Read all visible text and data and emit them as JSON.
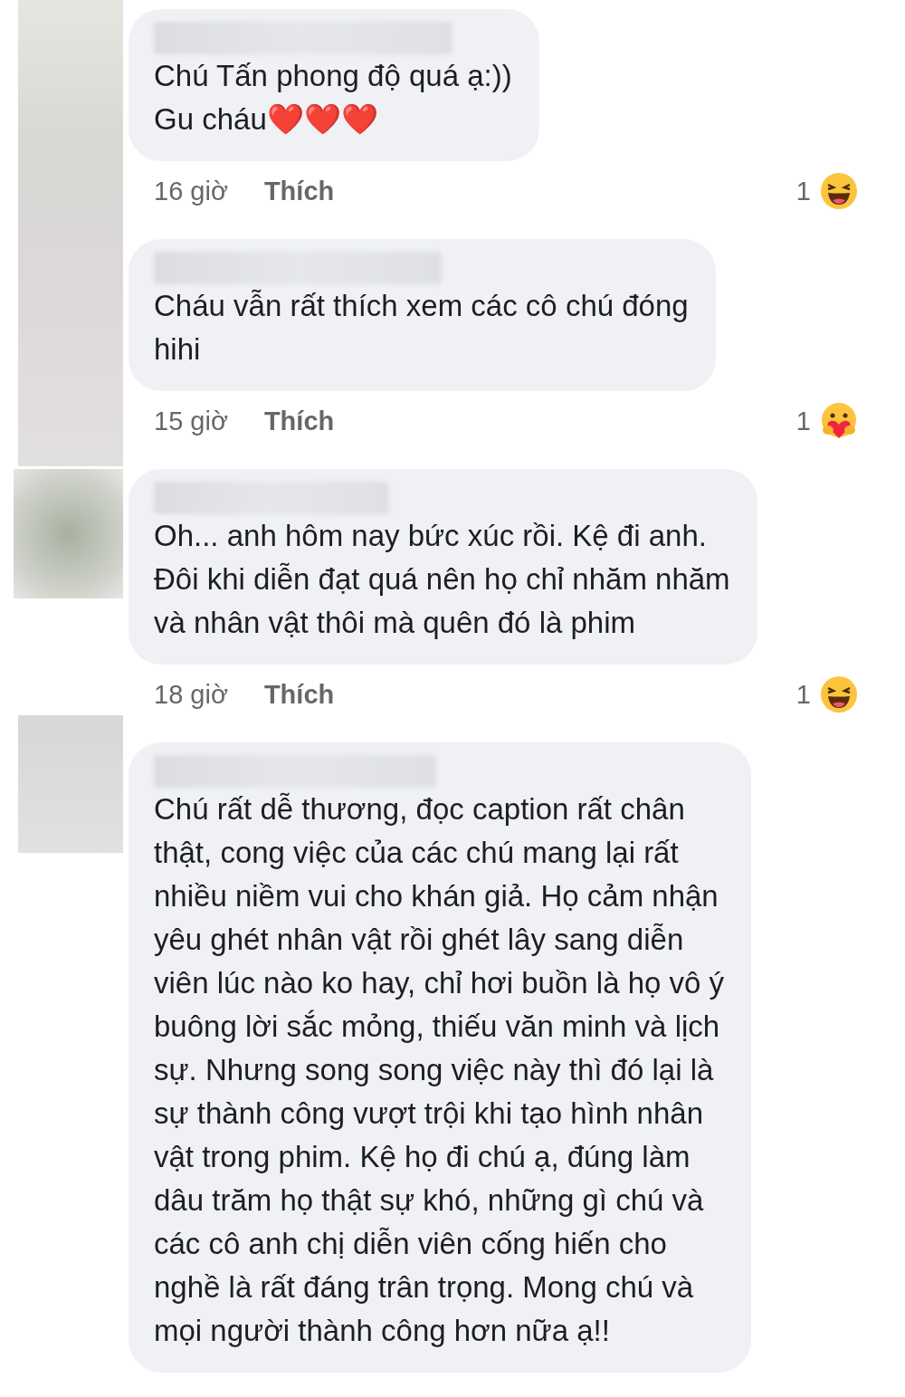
{
  "comments": [
    {
      "text": "Chú Tấn phong độ quá ạ:))\nGu cháu❤️❤️❤️",
      "time": "16 giờ",
      "like": "Thích",
      "reaction_count": "1",
      "reaction": {
        "kind": "haha"
      }
    },
    {
      "text": "Cháu vẫn rất thích xem các cô chú đóng\nhihi",
      "time": "15 giờ",
      "like": "Thích",
      "reaction_count": "1",
      "reaction": {
        "kind": "care"
      }
    },
    {
      "text": "Oh... anh hôm nay bức xúc rồi. Kệ đi anh.\nĐôi khi diễn đạt quá nên họ chỉ nhăm nhăm\nvà nhân vật thôi mà quên đó là phim",
      "time": "18 giờ",
      "like": "Thích",
      "reaction_count": "1",
      "reaction": {
        "kind": "haha"
      }
    },
    {
      "text": "Chú rất dễ thương, đọc caption rất chân\nthật, cong việc của các chú mang lại rất\nnhiều niềm vui cho khán giả. Họ cảm nhận\nyêu ghét nhân vật rồi ghét lây sang diễn\nviên lúc nào ko hay, chỉ hơi buồn là họ vô ý\nbuông lời sắc mỏng, thiếu văn minh và lịch\nsự. Nhưng song song việc này thì đó lại là\nsự thành công vượt trội khi tạo hình nhân\nvật trong phim. Kệ họ đi chú ạ, đúng làm\ndâu trăm họ thật sự khó, những gì chú và\ncác cô anh chị diễn viên cống hiến cho\nnghề là rất đáng trân trọng. Mong chú và\nmọi người thành công hơn nữa ạ!!"
    }
  ]
}
